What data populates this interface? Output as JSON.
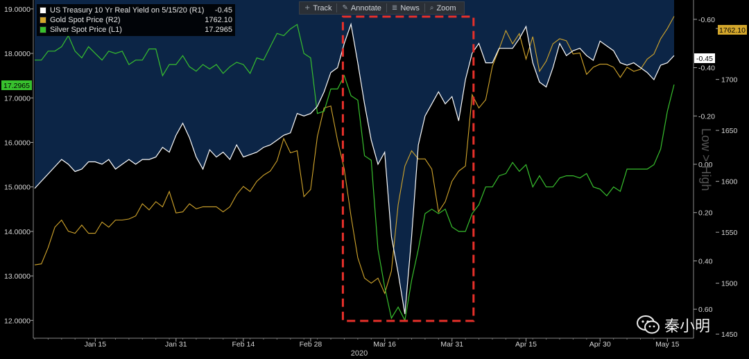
{
  "toolbar": {
    "track_label": "Track",
    "annotate_label": "Annotate",
    "news_label": "News",
    "zoom_label": "Zoom"
  },
  "legend": [
    {
      "name": "US Treasury 10 Yr Real Yield on 5/15/20 (R1)",
      "value": "-0.45",
      "color": "#ffffff"
    },
    {
      "name": "Gold Spot Price (R2)",
      "value": "1762.10",
      "color": "#d4a72c"
    },
    {
      "name": "Silver Spot Price (L1)",
      "value": "17.2965",
      "color": "#38c12e"
    }
  ],
  "axis_labels": {
    "r1_title": "Low > High",
    "x_year": "2020"
  },
  "last_value_tags": {
    "silver": "17.2965",
    "gold": "1762.10",
    "yield": "-0.45"
  },
  "watermark": {
    "text": "秦小明",
    "icon": "wechat-icon"
  },
  "colors": {
    "background": "#000000",
    "yield_fill": "#0c2546",
    "yield_line": "#ffffff",
    "gold": "#d4a72c",
    "silver": "#38c12e",
    "highlight_box": "#e8302a"
  },
  "chart_data": {
    "type": "line",
    "x_ticks": [
      "Jan 15",
      "Jan 31",
      "Feb 14",
      "Feb 28",
      "Mar 16",
      "Mar 31",
      "Apr 15",
      "Apr 30",
      "May 15"
    ],
    "x_tick_index": [
      9,
      21,
      31,
      41,
      52,
      62,
      73,
      84,
      94
    ],
    "left_axis": {
      "ticks": [
        "12.0000",
        "13.0000",
        "14.0000",
        "15.0000",
        "16.0000",
        "17.0000",
        "18.0000",
        "19.0000"
      ],
      "range": [
        11.6,
        19.2
      ]
    },
    "right_axis_r1": {
      "ticks": [
        "-0.60",
        "-0.40",
        "-0.20",
        "0.00",
        "0.20",
        "0.40",
        "0.60"
      ],
      "range": [
        -0.68,
        0.72
      ],
      "inverted": true
    },
    "right_axis_r2": {
      "ticks": [
        "1450",
        "1500",
        "1550",
        "1600",
        "1650",
        "1700",
        "1750"
      ],
      "range": [
        1446,
        1778
      ]
    },
    "highlight_box": {
      "x_start_index": 46,
      "x_end_index": 65
    },
    "series": [
      {
        "name": "US Treasury 10 Yr Real Yield on 5/15/20",
        "axis": "R1",
        "style": "area",
        "values": [
          0.1,
          0.07,
          0.04,
          0.01,
          -0.02,
          0.0,
          0.03,
          0.02,
          -0.01,
          -0.01,
          0.0,
          -0.02,
          0.02,
          0.0,
          -0.02,
          0.0,
          -0.02,
          -0.02,
          -0.03,
          -0.07,
          -0.05,
          -0.12,
          -0.17,
          -0.11,
          -0.03,
          0.02,
          -0.06,
          -0.03,
          -0.05,
          -0.02,
          -0.08,
          -0.03,
          -0.04,
          -0.05,
          -0.07,
          -0.08,
          -0.1,
          -0.12,
          -0.13,
          -0.21,
          -0.2,
          -0.21,
          -0.24,
          -0.3,
          -0.38,
          -0.4,
          -0.5,
          -0.58,
          -0.42,
          -0.25,
          -0.1,
          0.0,
          -0.05,
          0.3,
          0.45,
          0.62,
          0.3,
          -0.08,
          -0.2,
          -0.25,
          -0.3,
          -0.25,
          -0.28,
          -0.18,
          -0.35,
          -0.46,
          -0.5,
          -0.42,
          -0.42,
          -0.48,
          -0.48,
          -0.48,
          -0.52,
          -0.57,
          -0.42,
          -0.34,
          -0.32,
          -0.4,
          -0.5,
          -0.45,
          -0.47,
          -0.48,
          -0.45,
          -0.43,
          -0.51,
          -0.49,
          -0.47,
          -0.42,
          -0.41,
          -0.42,
          -0.4,
          -0.38,
          -0.35,
          -0.41,
          -0.42,
          -0.45
        ]
      },
      {
        "name": "Gold Spot Price",
        "axis": "R2",
        "style": "line",
        "values": [
          1518,
          1519,
          1535,
          1555,
          1562,
          1551,
          1549,
          1557,
          1549,
          1549,
          1560,
          1555,
          1562,
          1562,
          1563,
          1566,
          1578,
          1572,
          1580,
          1575,
          1590,
          1569,
          1570,
          1578,
          1573,
          1575,
          1575,
          1575,
          1570,
          1575,
          1587,
          1595,
          1590,
          1600,
          1606,
          1610,
          1620,
          1642,
          1628,
          1630,
          1585,
          1592,
          1644,
          1672,
          1674,
          1640,
          1612,
          1566,
          1525,
          1505,
          1500,
          1505,
          1490,
          1512,
          1577,
          1615,
          1630,
          1622,
          1622,
          1612,
          1570,
          1580,
          1600,
          1610,
          1615,
          1685,
          1672,
          1680,
          1713,
          1730,
          1748,
          1735,
          1745,
          1720,
          1742,
          1708,
          1718,
          1735,
          1740,
          1738,
          1725,
          1726,
          1705,
          1712,
          1715,
          1715,
          1712,
          1702,
          1712,
          1708,
          1710,
          1720,
          1725,
          1740,
          1750,
          1762
        ]
      },
      {
        "name": "Silver Spot Price",
        "axis": "L1",
        "style": "line",
        "values": [
          17.85,
          17.85,
          18.05,
          18.05,
          18.15,
          18.4,
          18.05,
          17.9,
          18.15,
          18.0,
          17.85,
          18.05,
          18.0,
          18.05,
          17.75,
          17.85,
          17.85,
          18.1,
          18.1,
          17.5,
          17.75,
          17.75,
          17.95,
          17.7,
          17.6,
          17.75,
          17.65,
          17.75,
          17.55,
          17.7,
          17.8,
          17.75,
          17.55,
          17.9,
          17.85,
          18.15,
          18.45,
          18.4,
          18.55,
          18.65,
          18.0,
          17.9,
          16.65,
          16.7,
          17.2,
          17.2,
          17.5,
          17.05,
          16.95,
          15.7,
          15.6,
          13.6,
          12.75,
          12.05,
          12.3,
          12.0,
          12.9,
          13.6,
          14.4,
          14.5,
          14.4,
          14.5,
          14.1,
          14.0,
          14.0,
          14.4,
          14.6,
          15.0,
          15.0,
          15.25,
          15.3,
          15.55,
          15.35,
          15.5,
          15.0,
          15.25,
          15.0,
          15.0,
          15.2,
          15.25,
          15.25,
          15.2,
          15.3,
          15.0,
          14.95,
          14.8,
          15.0,
          14.9,
          15.4,
          15.4,
          15.4,
          15.4,
          15.5,
          15.85,
          16.7,
          17.3
        ]
      }
    ]
  }
}
